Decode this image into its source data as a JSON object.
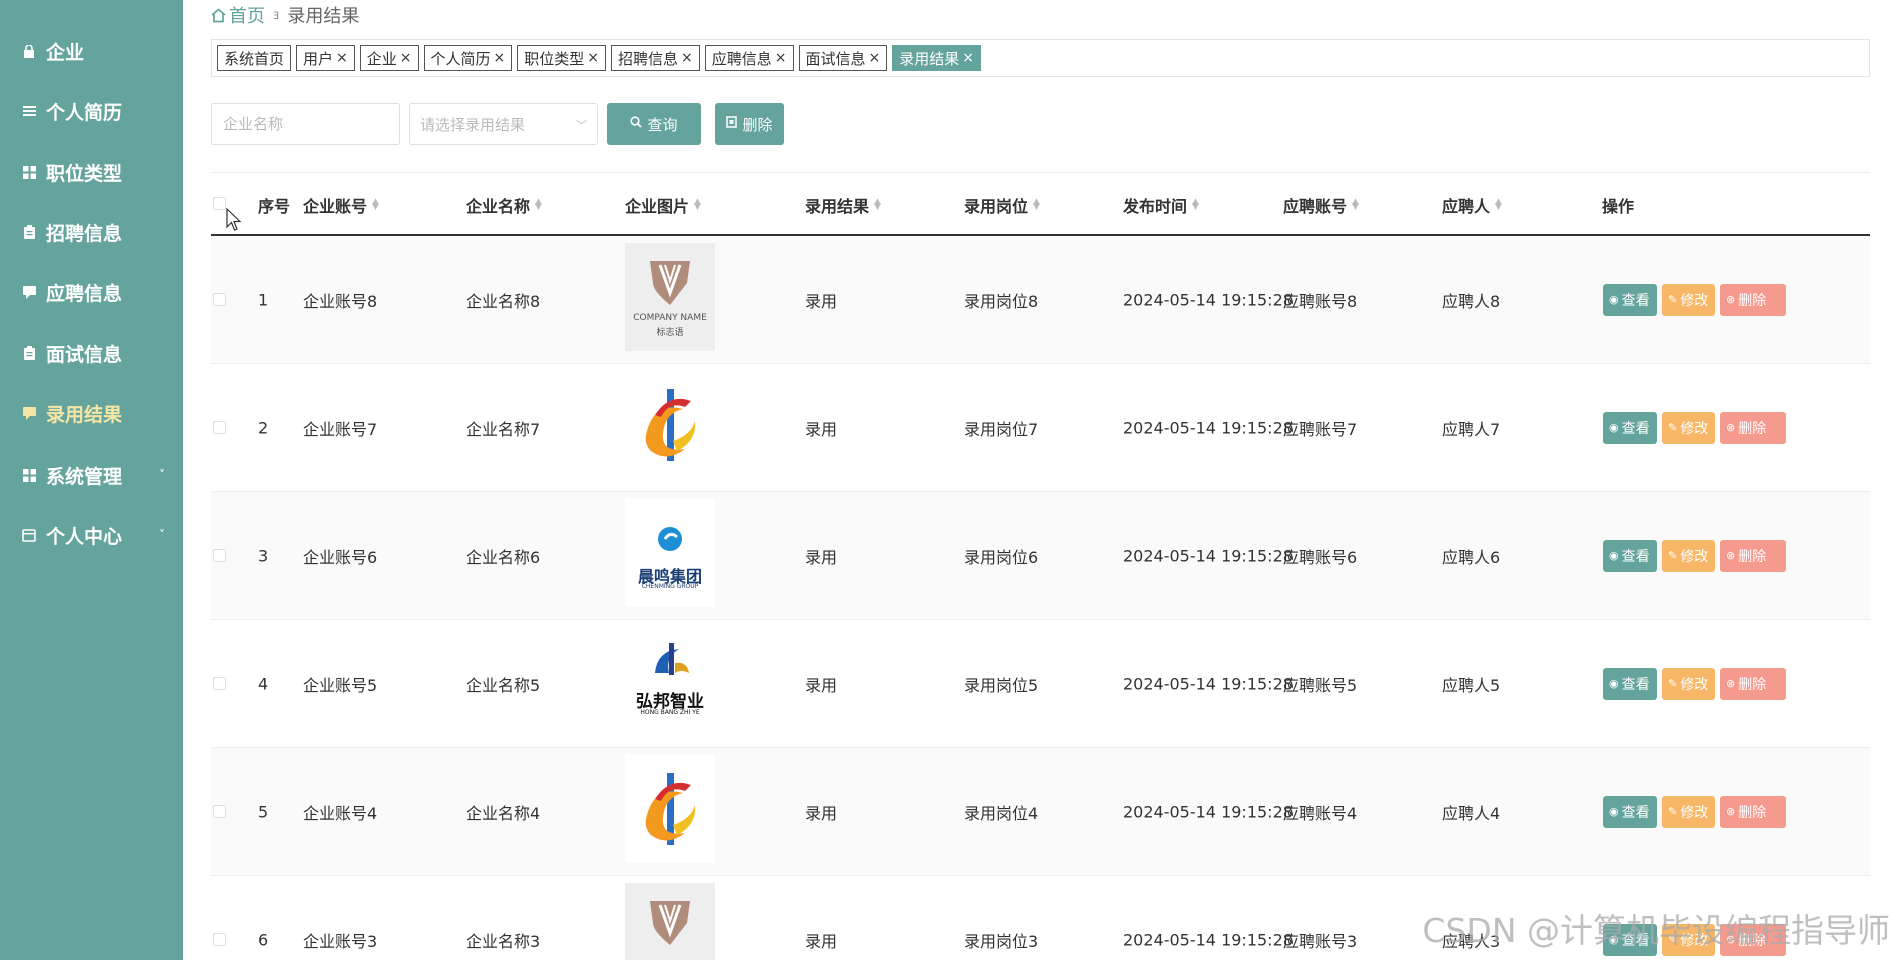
{
  "sidebar": {
    "items": [
      {
        "label": "企业",
        "icon": "lock-icon"
      },
      {
        "label": "个人简历",
        "icon": "list-icon"
      },
      {
        "label": "职位类型",
        "icon": "grid-icon"
      },
      {
        "label": "招聘信息",
        "icon": "clipboard-icon"
      },
      {
        "label": "应聘信息",
        "icon": "comment-icon"
      },
      {
        "label": "面试信息",
        "icon": "clipboard-icon"
      },
      {
        "label": "录用结果",
        "icon": "comment-icon",
        "active": true
      },
      {
        "label": "系统管理",
        "icon": "grid-icon",
        "chevron": "˅"
      },
      {
        "label": "个人中心",
        "icon": "folder-icon",
        "chevron": "˅"
      }
    ]
  },
  "breadcrumb": {
    "home": "首页",
    "sep": "ⱻ",
    "current": "录用结果"
  },
  "tags": [
    {
      "label": "系统首页",
      "closable": false
    },
    {
      "label": "用户",
      "closable": true
    },
    {
      "label": "企业",
      "closable": true
    },
    {
      "label": "个人简历",
      "closable": true
    },
    {
      "label": "职位类型",
      "closable": true
    },
    {
      "label": "招聘信息",
      "closable": true
    },
    {
      "label": "应聘信息",
      "closable": true
    },
    {
      "label": "面试信息",
      "closable": true
    },
    {
      "label": "录用结果",
      "closable": true,
      "active": true
    }
  ],
  "search": {
    "company_placeholder": "企业名称",
    "result_placeholder": "请选择录用结果",
    "query_label": "查询",
    "delete_label": "删除"
  },
  "table": {
    "headers": {
      "index": "序号",
      "account": "企业账号",
      "name": "企业名称",
      "image": "企业图片",
      "result": "录用结果",
      "position": "录用岗位",
      "time": "发布时间",
      "applicant_account": "应聘账号",
      "applicant": "应聘人",
      "ops": "操作"
    },
    "rows": [
      {
        "index": "1",
        "account": "企业账号8",
        "name": "企业名称8",
        "logo": "shield-logo",
        "logo_text": "COMPANY NAME",
        "logo_sub": "标志语",
        "result": "录用",
        "position": "录用岗位8",
        "time": "2024-05-14 19:15:28",
        "applicant_account": "应聘账号8",
        "applicant": "应聘人8"
      },
      {
        "index": "2",
        "account": "企业账号7",
        "name": "企业名称7",
        "logo": "flame-logo",
        "result": "录用",
        "position": "录用岗位7",
        "time": "2024-05-14 19:15:28",
        "applicant_account": "应聘账号7",
        "applicant": "应聘人7"
      },
      {
        "index": "3",
        "account": "企业账号6",
        "name": "企业名称6",
        "logo": "chenming-logo",
        "logo_text": "晨鸣集团",
        "logo_sub": "CHENMING GROUP",
        "result": "录用",
        "position": "录用岗位6",
        "time": "2024-05-14 19:15:28",
        "applicant_account": "应聘账号6",
        "applicant": "应聘人6"
      },
      {
        "index": "4",
        "account": "企业账号5",
        "name": "企业名称5",
        "logo": "hongbang-logo",
        "logo_text": "弘邦智业",
        "logo_sub": "HONG BANG ZHI YE",
        "result": "录用",
        "position": "录用岗位5",
        "time": "2024-05-14 19:15:28",
        "applicant_account": "应聘账号5",
        "applicant": "应聘人5"
      },
      {
        "index": "5",
        "account": "企业账号4",
        "name": "企业名称4",
        "logo": "flame-logo",
        "result": "录用",
        "position": "录用岗位4",
        "time": "2024-05-14 19:15:28",
        "applicant_account": "应聘账号4",
        "applicant": "应聘人4"
      },
      {
        "index": "6",
        "account": "企业账号3",
        "name": "企业名称3",
        "logo": "shield-logo",
        "result": "录用",
        "position": "录用岗位3",
        "time": "2024-05-14 19:15:28",
        "applicant_account": "应聘账号3",
        "applicant": "应聘人3"
      }
    ],
    "actions": {
      "view": "查看",
      "edit": "修改",
      "delete": "删除"
    }
  },
  "watermark": "CSDN @计算机毕设编程指导师",
  "colors": {
    "primary": "#64a49c",
    "active_menu": "#f5e6a6",
    "edit": "#f7b766",
    "delete": "#f59a8e"
  }
}
